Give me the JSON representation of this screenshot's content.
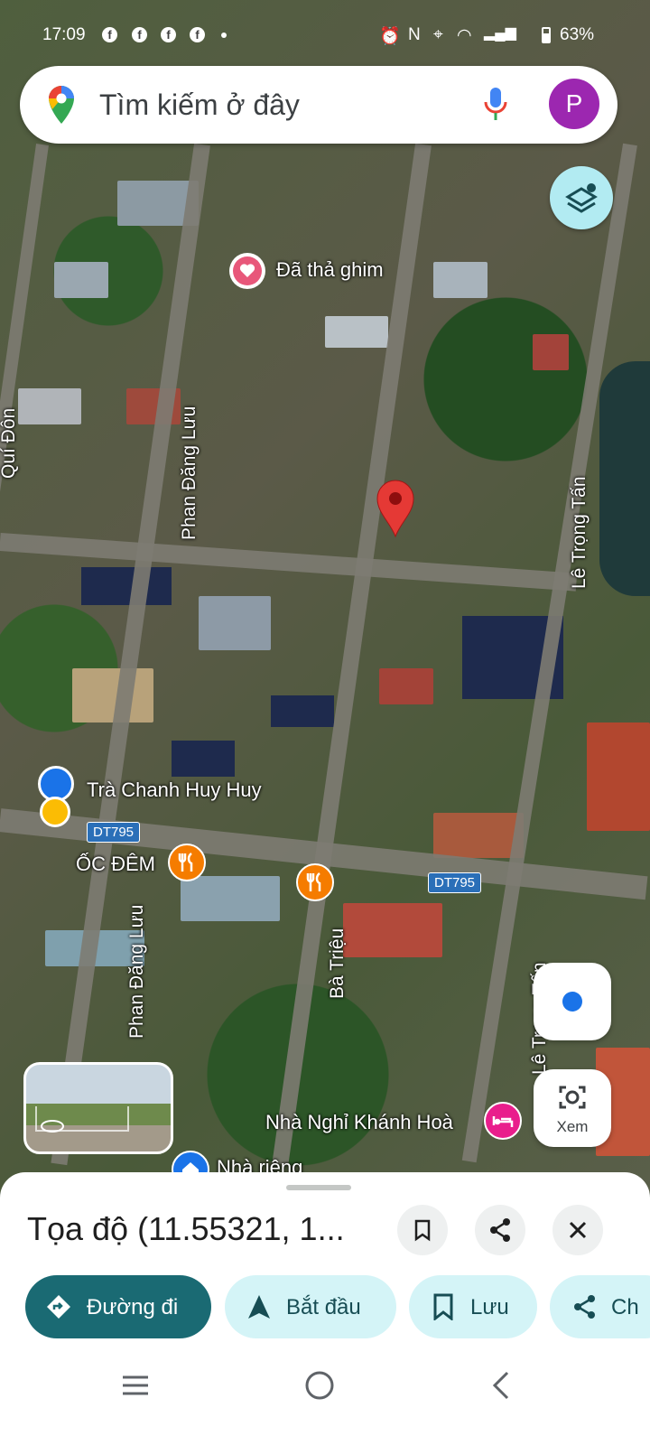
{
  "status_bar": {
    "time": "17:09",
    "notification_icons": [
      "facebook-icon",
      "facebook-icon",
      "facebook-icon",
      "facebook-icon"
    ],
    "right_icons": [
      "alarm-icon",
      "nfc-icon",
      "location-icon",
      "wifi-icon",
      "signal-icon",
      "signal-icon",
      "battery-icon"
    ],
    "battery": "63%"
  },
  "search": {
    "placeholder": "Tìm kiếm ở đây",
    "avatar_letter": "P"
  },
  "map": {
    "pinned_label": "Đã thả ghim",
    "streets": {
      "phan_dang_luu": "Phan Đăng Lưu",
      "le_trong_tan": "Lê Trọng Tấn",
      "ba_trieu": "Bà Triệu",
      "left_street_partial": "Quí Đôn",
      "le_trong_tan_partial": "Lê Trọng Tấn"
    },
    "road_badge": "DT795",
    "places": {
      "tra_chanh": "Trà Chanh Huy Huy",
      "oc_dem": "ỐC ĐÊM",
      "nha_nghi": "Nhà Nghỉ Khánh Hoà",
      "nha_rieng": "Nhà riêng"
    },
    "colors": {
      "pin": "#e53935",
      "restaurant": "#f57c00",
      "hotel": "#e91e8c",
      "pinned": "#e8577a"
    }
  },
  "xem_label": "Xem",
  "sheet": {
    "coord_title": "Tọa độ (11.55321, 1...",
    "actions": {
      "directions": "Đường đi",
      "start": "Bắt đầu",
      "save": "Lưu",
      "share_partial": "Ch"
    },
    "accent": "#1a6a73",
    "chip_bg": "#d4f4f7"
  }
}
